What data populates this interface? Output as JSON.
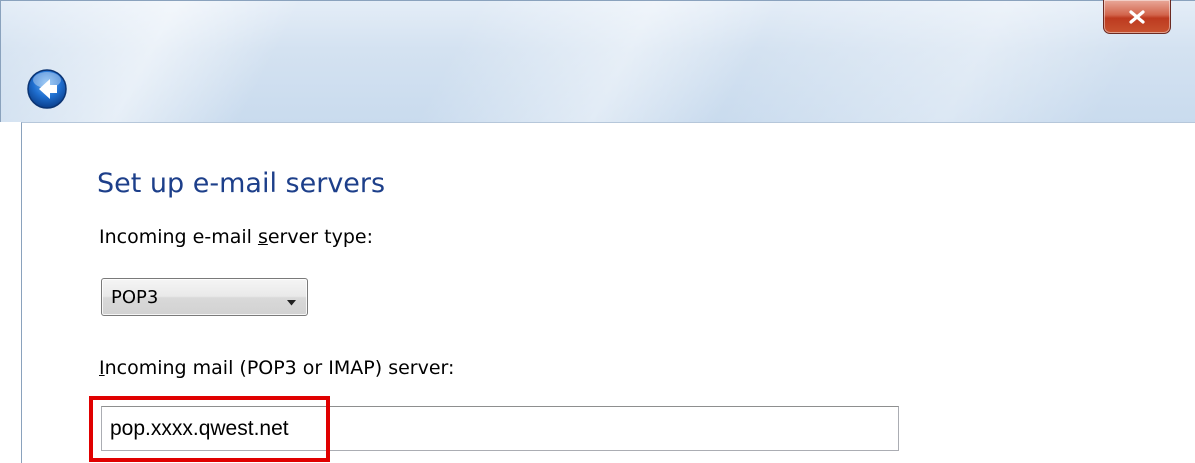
{
  "titlebar": {
    "close_icon": "close-icon",
    "back_icon": "back-arrow-icon"
  },
  "page": {
    "title": "Set up e-mail servers"
  },
  "incoming_type": {
    "label_before": "Incoming e-mail ",
    "label_access_key": "s",
    "label_after": "erver type:",
    "selected": "POP3",
    "arrow_icon": "chevron-down-icon"
  },
  "incoming_server": {
    "label_access_key": "I",
    "label_rest": "ncoming mail (POP3 or IMAP) server:",
    "value": "pop.xxxx.qwest.net"
  },
  "colors": {
    "title": "#1d3f8a",
    "highlight": "#e00000",
    "close_button": "#c8522f"
  }
}
